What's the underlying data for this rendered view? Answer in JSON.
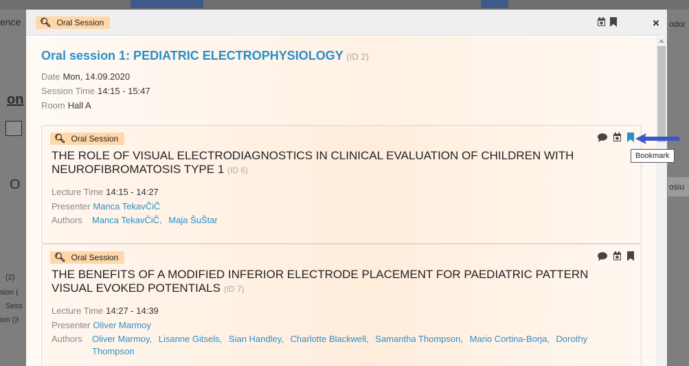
{
  "background": {
    "left_snippets": [
      "ence",
      "on",
      "O",
      "(2)",
      "sion (",
      "Sess",
      "ion (3"
    ],
    "right_snippets": [
      "odor",
      "osiu"
    ]
  },
  "modal": {
    "header": {
      "tag_label": "Oral Session",
      "search_icon": "search-icon",
      "calendar_icon": "calendar-add-icon",
      "bookmark_icon": "bookmark-icon",
      "close_label": "×"
    },
    "session": {
      "title": "Oral session 1: PEDIATRIC ELECTROPHYSIOLOGY",
      "id_label": "(ID 2)",
      "date_key": "Date",
      "date_value": "Mon, 14.09.2020",
      "time_key": "Session Time",
      "time_value": "14:15 - 15:47",
      "room_key": "Room",
      "room_value": "Hall A"
    },
    "lectures": [
      {
        "tag_label": "Oral Session",
        "title": "THE ROLE OF VISUAL ELECTRODIAGNOSTICS IN CLINICAL EVALUATION OF CHILDREN WITH NEUROFIBROMATOSIS TYPE 1",
        "id_label": "(ID 6)",
        "time_key": "Lecture Time",
        "time_value": "14:15 - 14:27",
        "presenter_key": "Presenter",
        "presenter": "Manca TekavČiČ",
        "authors_key": "Authors",
        "authors": [
          "Manca TekavČiČ,",
          "Maja ŠuŠtar"
        ],
        "bookmark_active": true
      },
      {
        "tag_label": "Oral Session",
        "title": "THE BENEFITS OF A MODIFIED INFERIOR ELECTRODE PLACEMENT FOR PAEDIATRIC PATTERN VISUAL EVOKED POTENTIALS",
        "id_label": "(ID 7)",
        "time_key": "Lecture Time",
        "time_value": "14:27 - 14:39",
        "presenter_key": "Presenter",
        "presenter": "Oliver Marmoy",
        "authors_key": "Authors",
        "authors": [
          "Oliver Marmoy,",
          "Lisanne Gitsels,",
          "Sian Handley,",
          "Charlotte Blackwell,",
          "Samantha Thompson,",
          "Mario Cortina-Borja,",
          "Dorothy Thompson"
        ],
        "bookmark_active": false
      }
    ],
    "tooltip": "Bookmark"
  },
  "colors": {
    "accent": "#2a8fc8",
    "tag_bg": "#ffd7a8",
    "active_bookmark": "#2a8fc8",
    "arrow": "#3b56c9"
  }
}
